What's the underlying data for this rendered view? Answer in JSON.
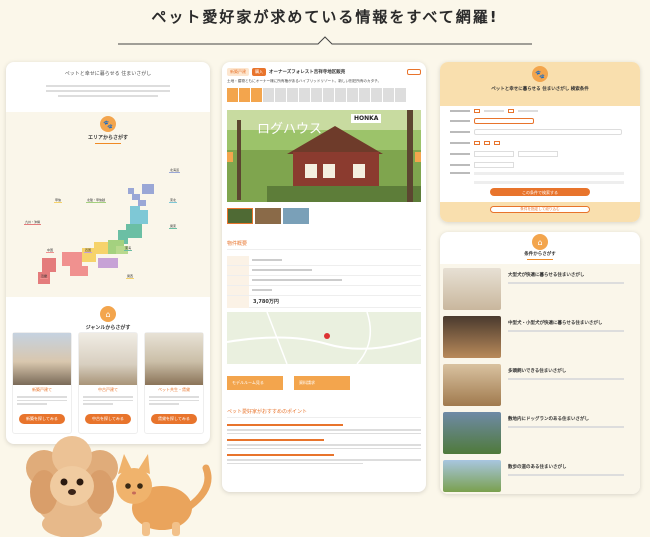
{
  "headline": "ペット愛好家が求めている情報をすべて網羅!",
  "colors": {
    "accent": "#e8742c",
    "accent_light": "#f3a54d",
    "bg": "#fbf7ea"
  },
  "left_card": {
    "title": "ペットと幸せに暮らせる 住まいさがし",
    "area_section": "エリアからさがす",
    "genre_section": "ジャンルからさがす",
    "genres": [
      {
        "label": "新築戸建て",
        "button": "新築を探してみる"
      },
      {
        "label": "中古戸建て",
        "button": "中古を探してみる"
      },
      {
        "label": "ペット共生・賃貸",
        "button": "賃貸を探してみる"
      }
    ]
  },
  "middle_card": {
    "tag_type": "新築戸建",
    "tag_status": "購入",
    "property_name": "オーナーズフォレスト吉祥寺地区販売",
    "subtitle": "土地・建物ともにオーナー様に所有権があるハイブリッドリゾート。新しい別荘所有のカタチ。",
    "photo_sign": "ログハウス",
    "photo_brand": "HONKA",
    "overview_heading": "物件概要",
    "price": "3,780万円",
    "btn_model": "モデルルーム見る",
    "btn_contact": "資料請求",
    "points_heading": "ペット愛好家がおすすめのポイント"
  },
  "top_right_card": {
    "title": "ペットと幸せに暮らせる 住まいさがし 検索条件",
    "search_button": "この条件で検索する",
    "clear_button": "条件を指定して絞り込む"
  },
  "bottom_right_card": {
    "title": "条件からさがす",
    "items": [
      {
        "label": "大型犬が快適に暮らせる住まいさがし"
      },
      {
        "label": "中型犬・小型犬が快適に暮らせる住まいさがし"
      },
      {
        "label": "多頭飼いできる住まいさがし"
      },
      {
        "label": "敷地内にドッグランのある住まいさがし"
      },
      {
        "label": "散歩の道のある住まいさがし"
      }
    ]
  }
}
